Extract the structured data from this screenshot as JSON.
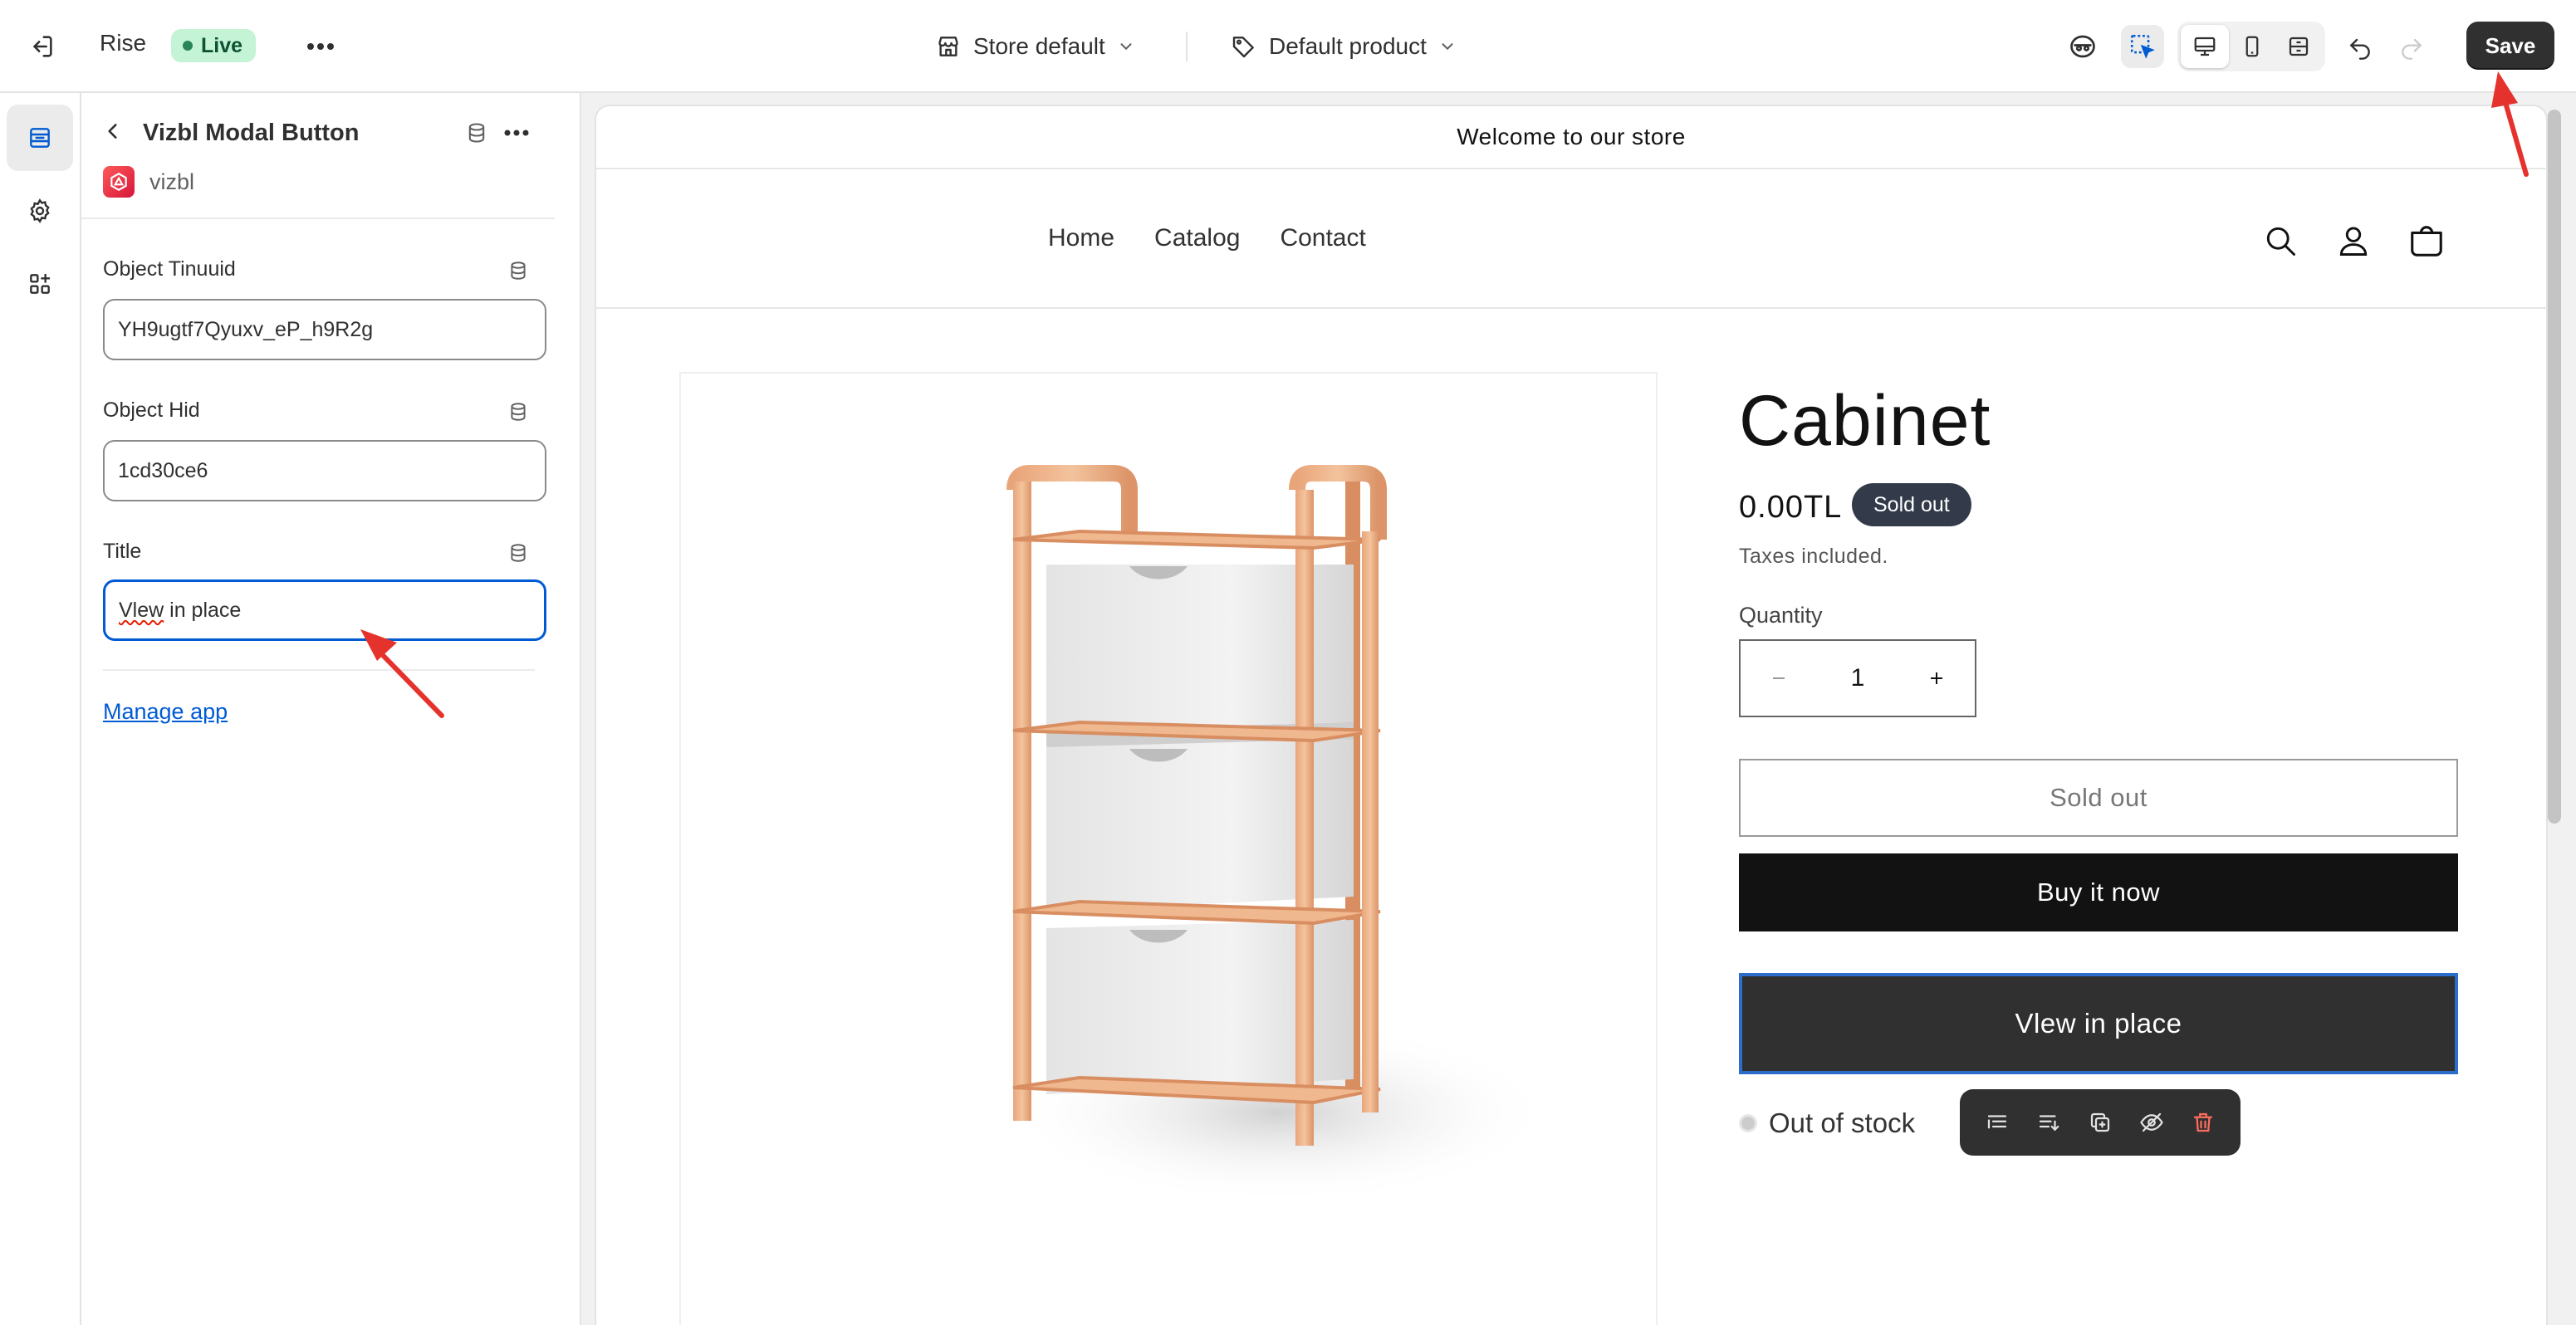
{
  "topbar": {
    "theme_name": "Rise",
    "live_label": "Live",
    "store_selector": "Store default",
    "template_selector": "Default product",
    "save_label": "Save"
  },
  "panel": {
    "title": "Vizbl Modal Button",
    "app_name": "vizbl",
    "fields": [
      {
        "label": "Object Tinuuid",
        "value": "YH9ugtf7Qyuxv_eP_h9R2g"
      },
      {
        "label": "Object Hid",
        "value": "1cd30ce6"
      },
      {
        "label": "Title",
        "value_misspelled": "Vlew",
        "value_rest": " in place"
      }
    ],
    "manage_link": "Manage app"
  },
  "preview": {
    "announcement": "Welcome to our store",
    "nav": [
      "Home",
      "Catalog",
      "Contact"
    ],
    "product": {
      "title": "Cabinet",
      "price": "0.00TL",
      "badge": "Sold out",
      "tax_note": "Taxes included.",
      "quantity_label": "Quantity",
      "quantity_value": "1",
      "sold_out_button": "Sold out",
      "buy_now_button": "Buy it now",
      "view_in_place_button": "Vlew in place",
      "stock_status": "Out of stock"
    }
  },
  "colors": {
    "accent": "#005bd3",
    "live_bg": "#c5f3d5",
    "annotation_arrow": "#e5322d",
    "button_dark": "#121212"
  }
}
